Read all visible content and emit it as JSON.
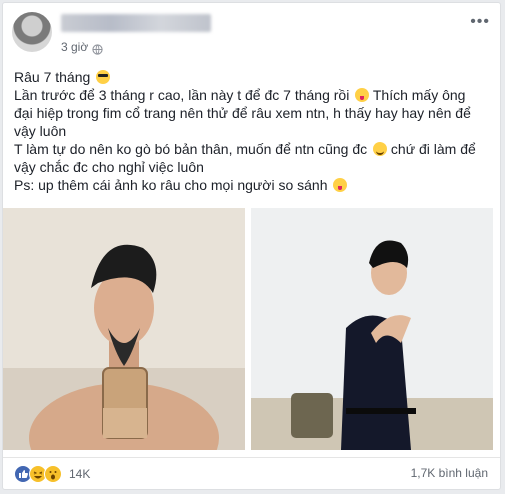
{
  "post": {
    "time": "3 giờ",
    "lines": [
      "Râu 7 tháng",
      "Lần trước để 3 tháng r cao, lần này t để đc 7 tháng rồi",
      "Thích mấy ông",
      "đại hiệp trong fim cổ trang nên thử để râu xem ntn, h thấy hay hay nên để",
      "vậy luôn",
      "T làm tự do nên ko gò bó bản thân, muốn để ntn cũng đc",
      "chứ đi làm để",
      "vậy chắc đc cho nghỉ việc luôn",
      "Ps: up thêm cái ảnh ko râu cho mọi người so sánh"
    ]
  },
  "footer": {
    "reaction_count": "14K",
    "comment_count": "1,7K bình luận"
  },
  "icons": {
    "reactions": [
      "like-icon",
      "haha-icon",
      "wow-icon"
    ],
    "more": "more-options-icon"
  },
  "colors": {
    "brand_blue": "#4267b2",
    "text": "#1d2129",
    "meta": "#616770"
  }
}
